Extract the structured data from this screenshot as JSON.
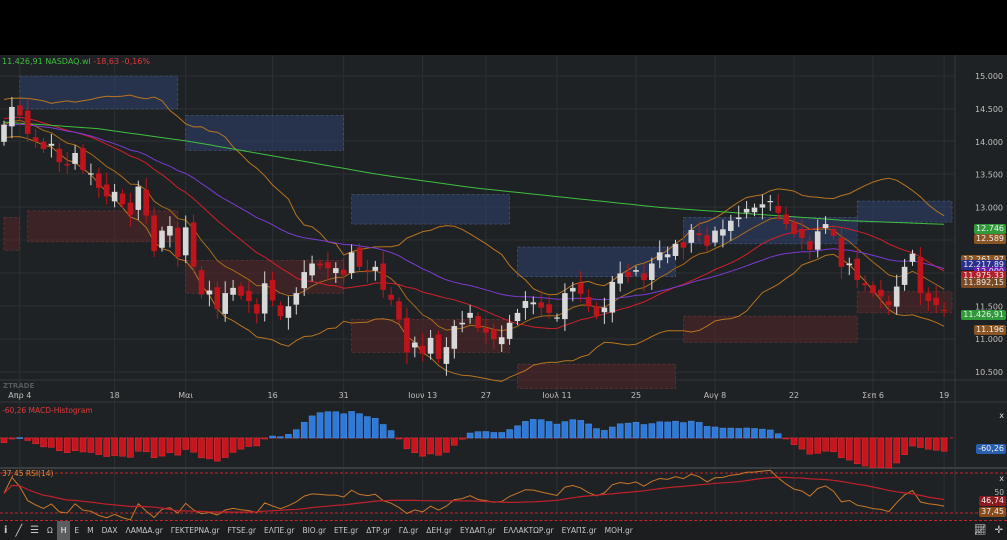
{
  "header": {
    "price": "11.426,91",
    "symbol": "NASDAQ.wl",
    "change": "-18,63",
    "change_pct": "-0,16%"
  },
  "watermark": "ZTRADE",
  "price_axis": [
    "15.000",
    "14.500",
    "14.000",
    "13.500",
    "13.000",
    "11.500",
    "11.000",
    "10.500"
  ],
  "price_tags": [
    {
      "label": "12.746",
      "color": "#2e9a3a"
    },
    {
      "label": "12.589",
      "color": "#8a5524"
    },
    {
      "label": "12.261,97",
      "color": "#8a5524"
    },
    {
      "label": "12.217,89",
      "color": "#2b2f8f"
    },
    {
      "label": "12.000",
      "color": "#6a1fb0"
    },
    {
      "label": "11.975,33",
      "color": "#b4202a"
    },
    {
      "label": "11.892,15",
      "color": "#7a4a22"
    },
    {
      "label": "11.426,91",
      "color": "#2e9a3a"
    },
    {
      "label": "11.196",
      "color": "#8a5524"
    }
  ],
  "date_axis": [
    {
      "label": "Απρ 4",
      "i": 2
    },
    {
      "label": "18",
      "i": 14
    },
    {
      "label": "Μαι",
      "i": 23
    },
    {
      "label": "16",
      "i": 34
    },
    {
      "label": "31",
      "i": 43
    },
    {
      "label": "Ιουν 13",
      "i": 53
    },
    {
      "label": "27",
      "i": 61
    },
    {
      "label": "Ιουλ 11",
      "i": 70
    },
    {
      "label": "25",
      "i": 80
    },
    {
      "label": "Αυγ 8",
      "i": 90
    },
    {
      "label": "22",
      "i": 100
    },
    {
      "label": "Σεπ 6",
      "i": 110
    },
    {
      "label": "19",
      "i": 119
    }
  ],
  "macd": {
    "label": "-60,26 MACD-Histogram",
    "value": "-60,26",
    "close": "x"
  },
  "rsi": {
    "label": "37,45 RSI(14)",
    "level": "50",
    "value": "37,45",
    "ma_value": "46,74",
    "close": "x"
  },
  "toolbar": {
    "items": [
      "Ω",
      "H",
      "E",
      "M",
      "DAX",
      "ΛΑΜΔΑ.gr",
      "ΓΕΚΤΕΡΝΑ.gr",
      "FTSE.gr",
      "ΕΛΠΕ.gr",
      "ΒΙΟ.gr",
      "ΕΤΕ.gr",
      "ΔΤΡ.gr",
      "ΓΔ.gr",
      "ΔΕΗ.gr",
      "ΕΥΔΑΠ.gr",
      "ΕΛΛΑΚΤΩΡ.gr",
      "ΕΥΑΠΣ.gr",
      "ΜΟΗ.gr"
    ],
    "active": "H"
  },
  "chart_data": {
    "type": "candlestick",
    "title": "NASDAQ.wl",
    "closes": [
      14260,
      14530,
      14400,
      14120,
      14000,
      13890,
      13970,
      13690,
      13640,
      13830,
      13570,
      13520,
      13300,
      13170,
      13240,
      13050,
      12890,
      13320,
      12880,
      12340,
      12650,
      12720,
      12250,
      12700,
      12100,
      11680,
      11740,
      11460,
      11700,
      11780,
      11660,
      11580,
      11390,
      11850,
      11590,
      11350,
      11500,
      11700,
      12020,
      12150,
      12120,
      12080,
      12080,
      11980,
      12320,
      12100,
      12040,
      12100,
      11750,
      11600,
      11300,
      10800,
      10950,
      10780,
      11020,
      10700,
      10880,
      11200,
      11250,
      11400,
      11170,
      11100,
      11000,
      11030,
      11250,
      11400,
      11580,
      11560,
      11480,
      11400,
      11330,
      11700,
      11780,
      11690,
      11500,
      11360,
      11480,
      11870,
      12000,
      11950,
      12050,
      11900,
      12150,
      12320,
      12290,
      12450,
      12390,
      12660,
      12580,
      12420,
      12650,
      12670,
      12800,
      12850,
      12980,
      13000,
      13050,
      13100,
      12920,
      12750,
      12600,
      12540,
      12360,
      12640,
      12750,
      12570,
      12100,
      12150,
      11900,
      11820,
      11700,
      11650,
      11520,
      11800,
      12100,
      12300,
      11700,
      11580,
      11520,
      11426.91
    ],
    "long_ma": [
      14300,
      14200,
      14000,
      13750,
      13500,
      13300,
      13150,
      13000,
      12900,
      12800,
      12746
    ],
    "zones": [
      {
        "type": "supply",
        "from": 2,
        "to": 22,
        "low": 14500,
        "high": 15000
      },
      {
        "type": "supply",
        "from": 23,
        "to": 43,
        "low": 13870,
        "high": 14400
      },
      {
        "type": "supply",
        "from": 44,
        "to": 64,
        "low": 12750,
        "high": 13200
      },
      {
        "type": "supply",
        "from": 65,
        "to": 85,
        "low": 11950,
        "high": 12400
      },
      {
        "type": "supply",
        "from": 86,
        "to": 108,
        "low": 12450,
        "high": 12850
      },
      {
        "type": "supply",
        "from": 108,
        "to": 120,
        "low": 12780,
        "high": 13100
      },
      {
        "type": "demand",
        "from": 0,
        "to": 2,
        "low": 12350,
        "high": 12850
      },
      {
        "type": "demand",
        "from": 3,
        "to": 22,
        "low": 12480,
        "high": 12950
      },
      {
        "type": "demand",
        "from": 23,
        "to": 43,
        "low": 11700,
        "high": 12200
      },
      {
        "type": "demand",
        "from": 44,
        "to": 64,
        "low": 10800,
        "high": 11300
      },
      {
        "type": "demand",
        "from": 65,
        "to": 85,
        "low": 10250,
        "high": 10620
      },
      {
        "type": "demand",
        "from": 86,
        "to": 108,
        "low": 10950,
        "high": 11350
      },
      {
        "type": "demand",
        "from": 108,
        "to": 120,
        "low": 11400,
        "high": 11720
      }
    ],
    "ylim": [
      10300,
      15100
    ]
  }
}
